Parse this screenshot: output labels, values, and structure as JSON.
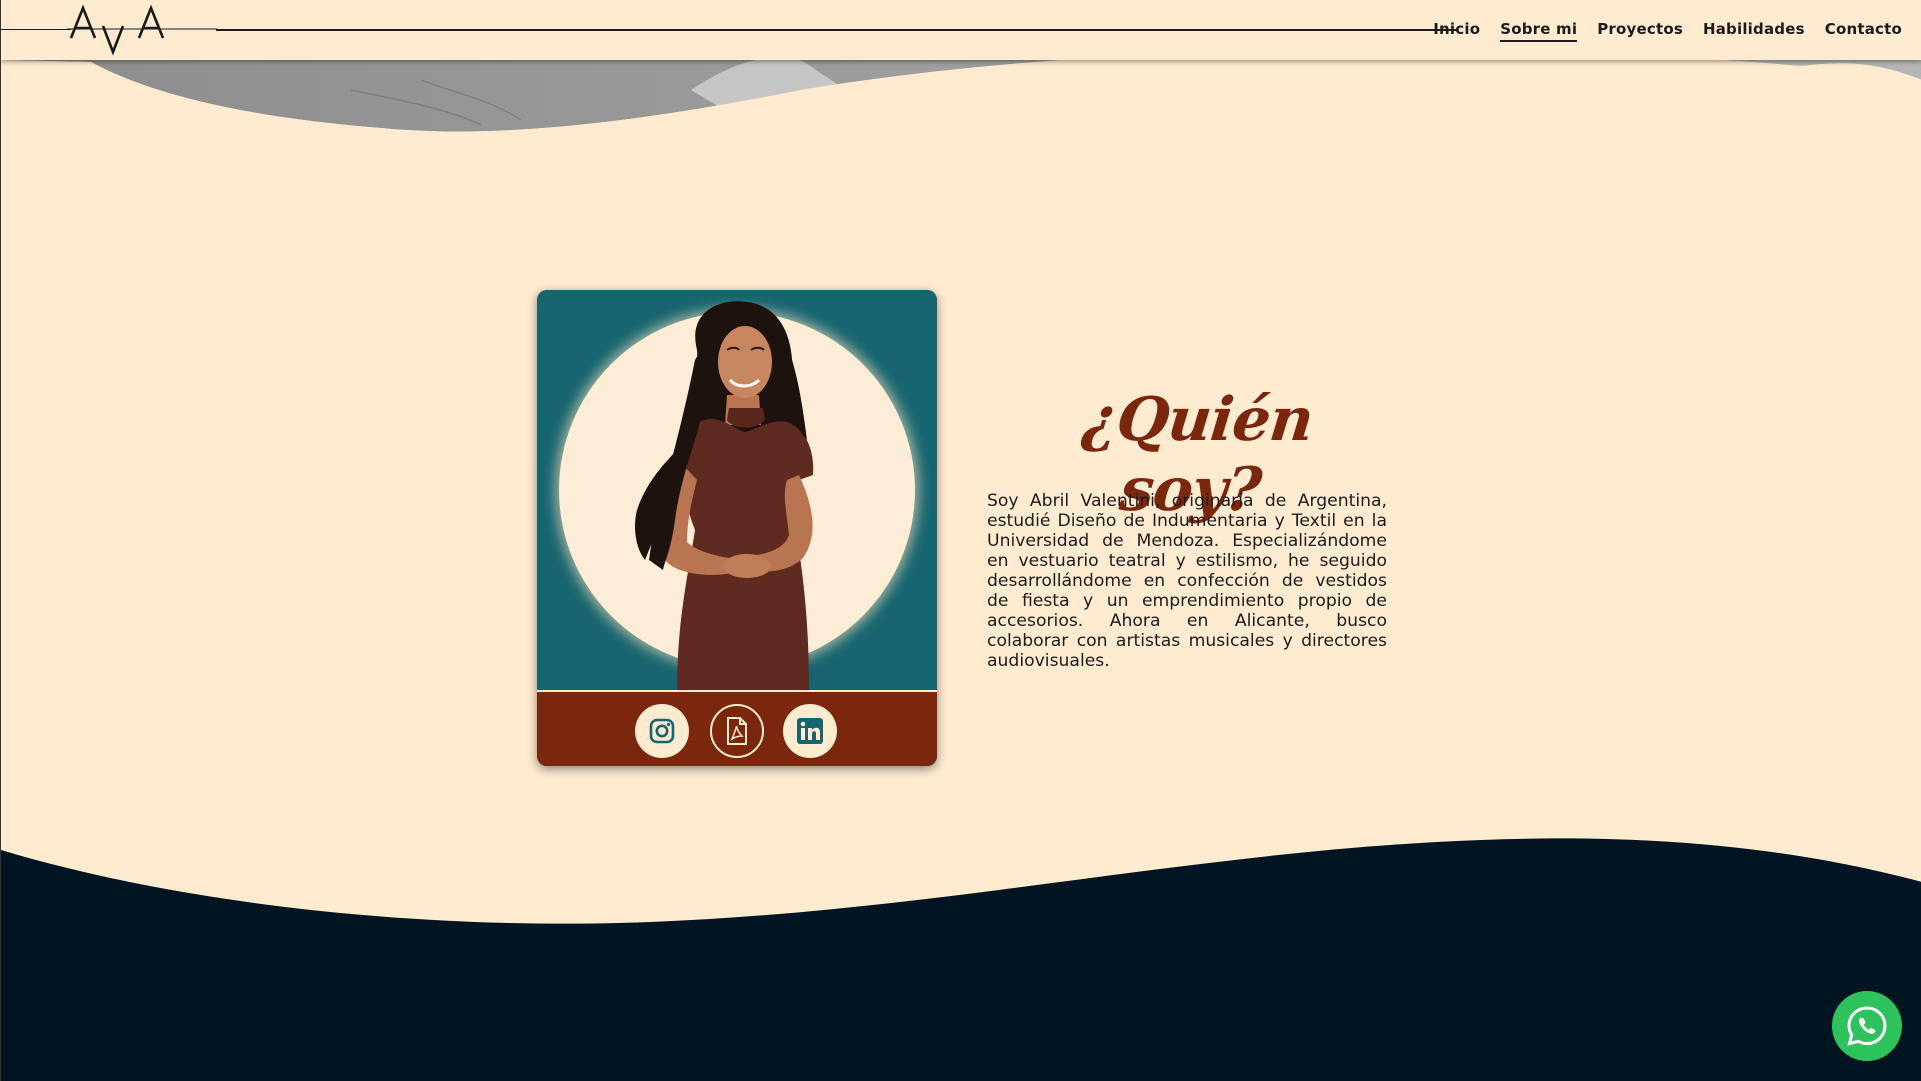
{
  "brand": {
    "logo_text": "AvA"
  },
  "nav": {
    "items": [
      {
        "label": "Inicio",
        "active": false
      },
      {
        "label": "Sobre mi",
        "active": true
      },
      {
        "label": "Proyectos",
        "active": false
      },
      {
        "label": "Habilidades",
        "active": false
      },
      {
        "label": "Contacto",
        "active": false
      }
    ]
  },
  "about": {
    "title": "¿Quién soy?",
    "text": "Soy Abril Valentini, originaria de Argentina, estudié Diseño de Indumentaria y Textil en la Universidad de Mendoza. Especializándome en vestuario teatral y estilismo, he seguido desarrollándome en confección de vestidos de fiesta y un emprendimiento propio de accesorios. Ahora en Alicante, busco colaborar con artistas musicales y directores audiovisuales."
  },
  "card": {
    "social": [
      {
        "icon": "instagram-icon"
      },
      {
        "icon": "pdf-cv-icon"
      },
      {
        "icon": "linkedin-icon"
      }
    ]
  },
  "floating": {
    "icon": "whatsapp-icon"
  },
  "colors": {
    "background": "#ffebd0",
    "accent_brown": "#7a270d",
    "teal": "#176570",
    "footer_navy": "#011421",
    "whatsapp_green": "#2ec25c"
  }
}
